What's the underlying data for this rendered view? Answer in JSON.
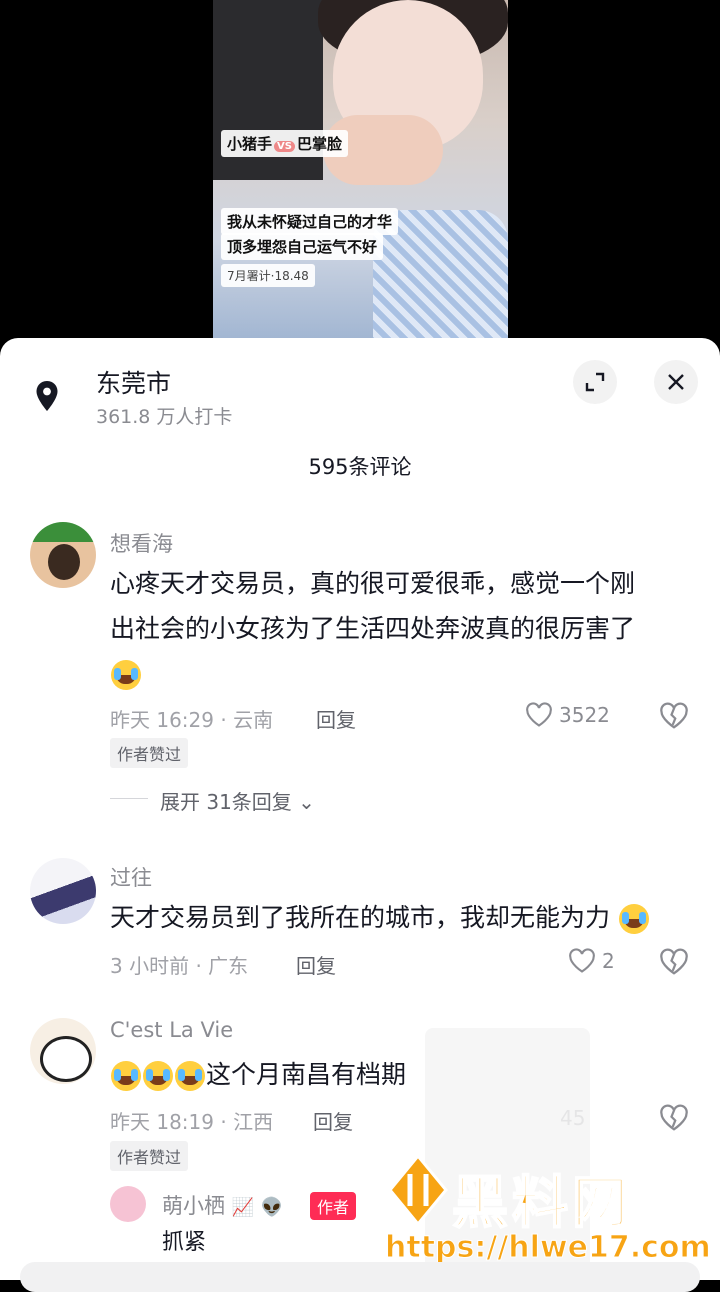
{
  "video": {
    "overlay_lines": [
      "小猪手",
      "VS",
      "巴掌脸",
      "我从未怀疑过自己的才华",
      "顶多埋怨自己运气不好",
      "7月署计·18.48"
    ]
  },
  "location": {
    "title": "东莞市",
    "subtitle": "361.8 万人打卡"
  },
  "comment_count": "595条评论",
  "comments": [
    {
      "username": "想看海",
      "text_line1": "心疼天才交易员，真的很可爱很乖，感觉一个刚",
      "text_line2": "出社会的小女孩为了生活四处奔波真的很厉害了",
      "meta": "昨天 16:29 · 云南",
      "reply_label": "回复",
      "likes": "3522",
      "badge": "作者赞过",
      "expand": "展开 31条回复"
    },
    {
      "username": "过往",
      "text": "天才交易员到了我所在的城市，我却无能为力",
      "meta": "3 小时前 · 广东",
      "reply_label": "回复",
      "likes": "2"
    },
    {
      "username": "C'est La Vie",
      "text": "这个月南昌有档期",
      "meta": "昨天 18:19 · 江西",
      "reply_label": "回复",
      "likes": "45",
      "badge": "作者赞过"
    }
  ],
  "sub_reply": {
    "username": "萌小栖",
    "author_tag": "作者",
    "text": "抓紧"
  },
  "watermark": {
    "brand": "黑料网",
    "url": "https://hlwe17.com"
  },
  "colors": {
    "accent": "#fe2c55",
    "watermark": "#f7a414"
  }
}
